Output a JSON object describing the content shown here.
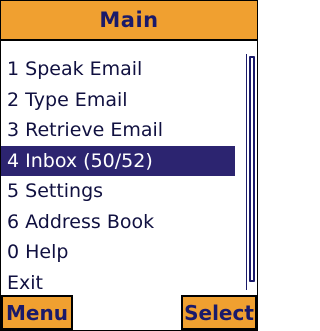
{
  "title": "Main",
  "menu": {
    "items": [
      {
        "label": "1 Speak Email",
        "selected": false
      },
      {
        "label": "2 Type Email",
        "selected": false
      },
      {
        "label": "3 Retrieve Email",
        "selected": false
      },
      {
        "label": "4 Inbox (50/52)",
        "selected": true
      },
      {
        "label": "5 Settings",
        "selected": false
      },
      {
        "label": "6 Address Book",
        "selected": false
      },
      {
        "label": "0 Help",
        "selected": false
      },
      {
        "label": "Exit",
        "selected": false
      }
    ]
  },
  "softkeys": {
    "left": "Menu",
    "right": "Select"
  },
  "colors": {
    "accent": "#f0a030",
    "selection": "#2c2470",
    "text": "#101040"
  }
}
